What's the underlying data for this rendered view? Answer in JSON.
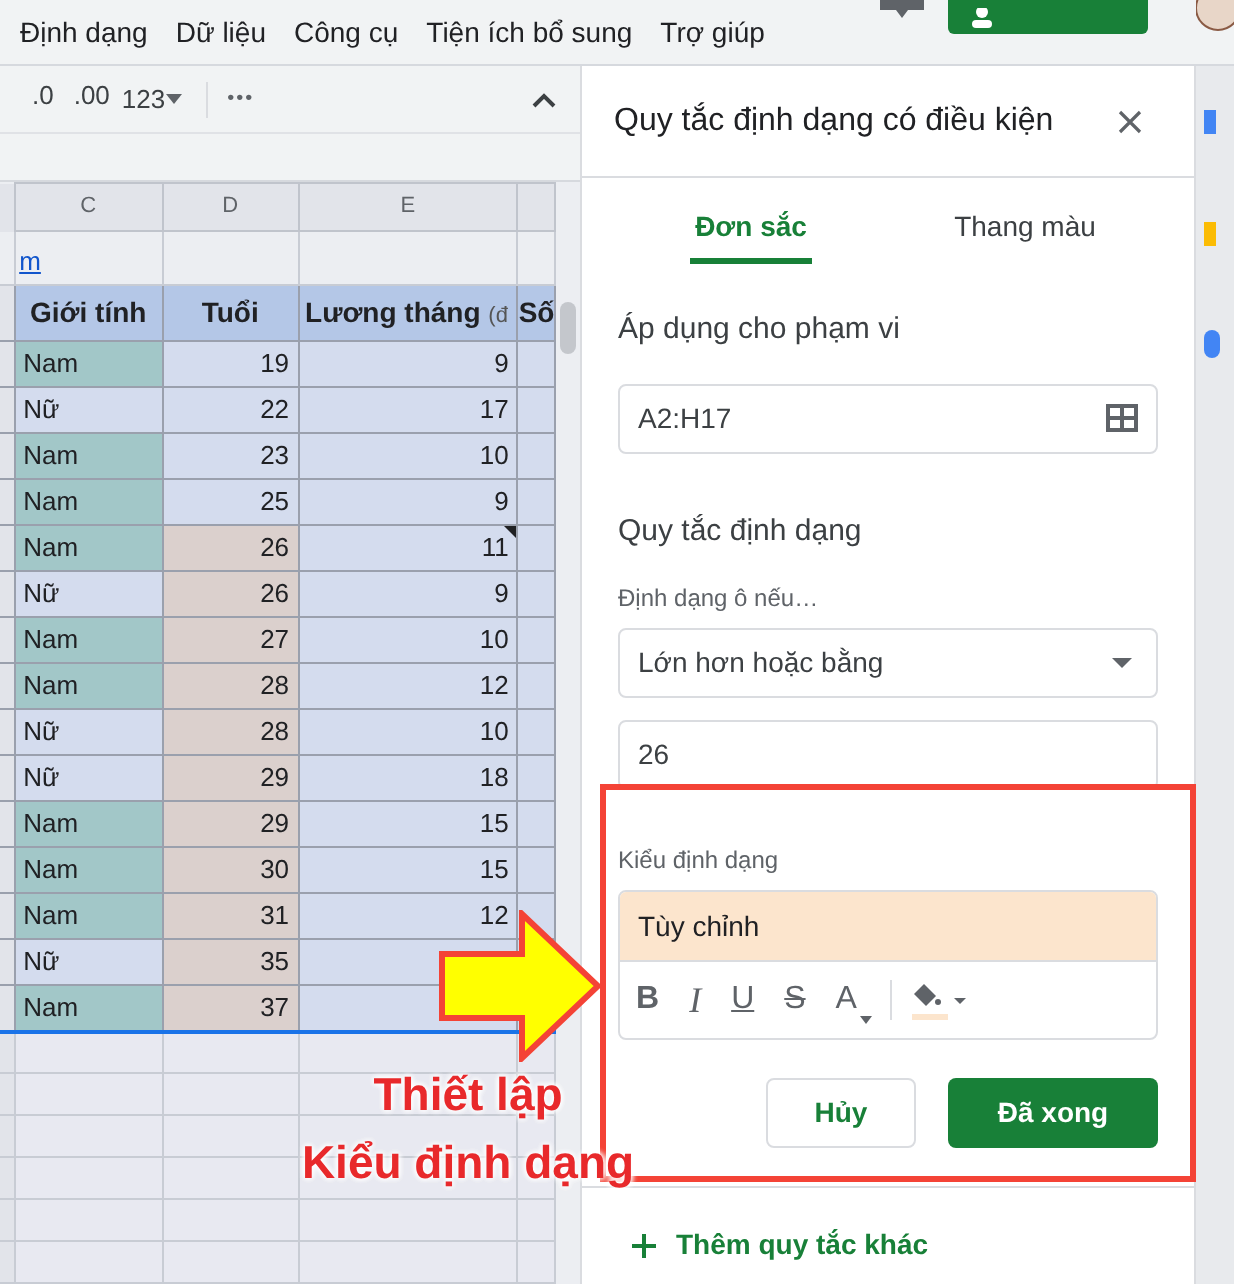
{
  "menu": [
    "Định dạng",
    "Dữ liệu",
    "Công cụ",
    "Tiện ích bổ sung",
    "Trợ giúp"
  ],
  "toolbar": {
    "decrease_decimal": ".0",
    "increase_decimal": ".00",
    "number_format": "123",
    "more": "•••"
  },
  "sheet": {
    "column_headers": [
      "C",
      "D",
      "E"
    ],
    "title_row_text": "m",
    "table_header": [
      {
        "text": "Giới tính"
      },
      {
        "text": "Tuổi"
      },
      {
        "text": "Lương tháng",
        "suffix": "(đ"
      },
      {
        "text": "Số"
      }
    ],
    "rows": [
      {
        "gender": "Nam",
        "gender_highlight": true,
        "age": "19",
        "age_highlight": false,
        "salary": "9",
        "note": false
      },
      {
        "gender": "Nữ",
        "gender_highlight": false,
        "age": "22",
        "age_highlight": false,
        "salary": "17",
        "note": false
      },
      {
        "gender": "Nam",
        "gender_highlight": true,
        "age": "23",
        "age_highlight": false,
        "salary": "10",
        "note": false
      },
      {
        "gender": "Nam",
        "gender_highlight": true,
        "age": "25",
        "age_highlight": false,
        "salary": "9",
        "note": false
      },
      {
        "gender": "Nam",
        "gender_highlight": true,
        "age": "26",
        "age_highlight": true,
        "salary": "11",
        "note": true
      },
      {
        "gender": "Nữ",
        "gender_highlight": false,
        "age": "26",
        "age_highlight": true,
        "salary": "9",
        "note": false
      },
      {
        "gender": "Nam",
        "gender_highlight": true,
        "age": "27",
        "age_highlight": true,
        "salary": "10",
        "note": false
      },
      {
        "gender": "Nam",
        "gender_highlight": true,
        "age": "28",
        "age_highlight": true,
        "salary": "12",
        "note": false
      },
      {
        "gender": "Nữ",
        "gender_highlight": false,
        "age": "28",
        "age_highlight": true,
        "salary": "10",
        "note": false
      },
      {
        "gender": "Nữ",
        "gender_highlight": false,
        "age": "29",
        "age_highlight": true,
        "salary": "18",
        "note": false
      },
      {
        "gender": "Nam",
        "gender_highlight": true,
        "age": "29",
        "age_highlight": true,
        "salary": "15",
        "note": false
      },
      {
        "gender": "Nam",
        "gender_highlight": true,
        "age": "30",
        "age_highlight": true,
        "salary": "15",
        "note": false
      },
      {
        "gender": "Nam",
        "gender_highlight": true,
        "age": "31",
        "age_highlight": true,
        "salary": "12",
        "note": false
      },
      {
        "gender": "Nữ",
        "gender_highlight": false,
        "age": "35",
        "age_highlight": true,
        "note": false
      },
      {
        "gender": "Nam",
        "gender_highlight": true,
        "age": "37",
        "age_highlight": true,
        "note": false
      }
    ]
  },
  "panel": {
    "title": "Quy tắc định dạng có điều kiện",
    "tabs": [
      {
        "label": "Đơn sắc",
        "selected": true
      },
      {
        "label": "Thang màu",
        "selected": false
      }
    ],
    "range_label": "Áp dụng cho phạm vi",
    "range_value": "A2:H17",
    "rules_label": "Quy tắc định dạng",
    "condition_label": "Định dạng ô nếu…",
    "condition_value": "Lớn hơn hoặc bằng",
    "condition_input": "26",
    "style_label": "Kiểu định dạng",
    "style_preview": "Tùy chỉnh",
    "style_tools": {
      "bold": "B",
      "italic": "I",
      "underline": "U",
      "strikethrough": "S",
      "text_color": "A"
    },
    "cancel": "Hủy",
    "done": "Đã xong",
    "add_rule": "Thêm quy tắc khác"
  },
  "annotation": {
    "lines": [
      "Thiết lập",
      "Kiểu định dạng"
    ]
  }
}
